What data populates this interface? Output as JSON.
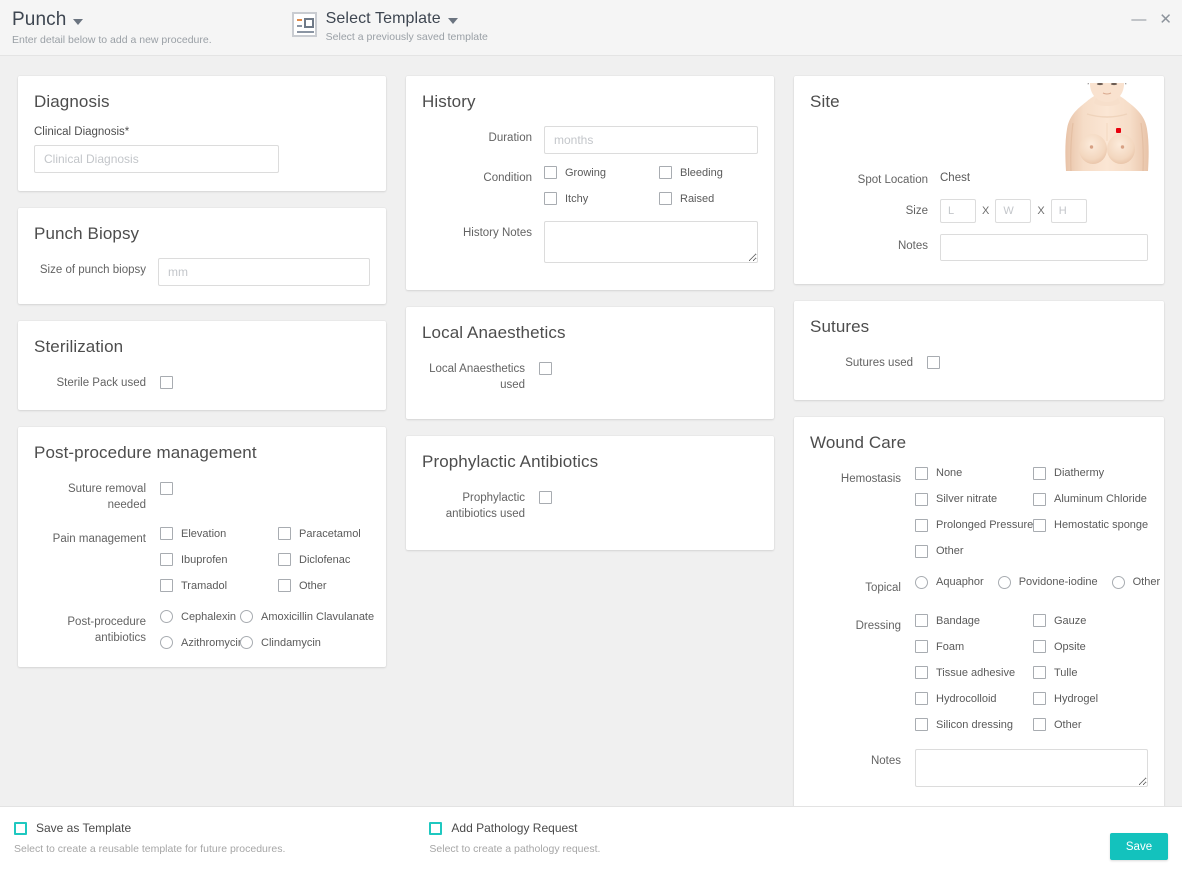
{
  "header": {
    "title": "Punch",
    "subtitle": "Enter detail below to add a new procedure.",
    "template_icon": "template-layout-icon",
    "template_title": "Select Template",
    "template_subtitle": "Select a previously saved template",
    "minimize_icon": "minimize-icon",
    "close_icon": "close-icon",
    "dropdown_icon": "chevron-down-icon"
  },
  "cards": {
    "diagnosis": {
      "title": "Diagnosis",
      "clinical_diagnosis_label": "Clinical Diagnosis*",
      "clinical_diagnosis_value": "",
      "clinical_diagnosis_placeholder": "Clinical Diagnosis"
    },
    "punch_biopsy": {
      "title": "Punch Biopsy",
      "size_label": "Size of punch biopsy",
      "size_value": "",
      "size_placeholder": "mm"
    },
    "sterilization": {
      "title": "Sterilization",
      "sterile_pack_label": "Sterile Pack used",
      "sterile_pack_checked": false
    },
    "post_procedure": {
      "title": "Post-procedure management",
      "suture_removal_label": "Suture removal needed",
      "suture_removal_checked": false,
      "pain_management_label": "Pain management",
      "pain_management_options": [
        "Elevation",
        "Paracetamol",
        "Ibuprofen",
        "Diclofenac",
        "Tramadol",
        "Other"
      ],
      "antibiotics_label": "Post-procedure antibiotics",
      "antibiotics_options": [
        "Cephalexin",
        "Amoxicillin Clavulanate",
        "Azithromycin",
        "Clindamycin"
      ]
    },
    "history": {
      "title": "History",
      "duration_label": "Duration",
      "duration_value": "",
      "duration_placeholder": "months",
      "condition_label": "Condition",
      "condition_options": [
        "Growing",
        "Bleeding",
        "Itchy",
        "Raised"
      ],
      "notes_label": "History Notes",
      "notes_value": ""
    },
    "local_anaesthetics": {
      "title": "Local Anaesthetics",
      "used_label": "Local Anaesthetics used",
      "used_checked": false
    },
    "prophylactic_antibiotics": {
      "title": "Prophylactic Antibiotics",
      "used_label": "Prophylactic antibiotics used",
      "used_checked": false
    },
    "site": {
      "title": "Site",
      "figure_name": "female-torso-body-map",
      "spot_marker_color": "#e8000d",
      "spot_location_label": "Spot Location",
      "spot_location_value": "Chest",
      "size_label": "Size",
      "size_l_placeholder": "L",
      "size_w_placeholder": "W",
      "size_h_placeholder": "H",
      "size_separator": "X",
      "notes_label": "Notes",
      "notes_value": ""
    },
    "sutures": {
      "title": "Sutures",
      "used_label": "Sutures used",
      "used_checked": false
    },
    "wound_care": {
      "title": "Wound Care",
      "hemostasis_label": "Hemostasis",
      "hemostasis_options": [
        "None",
        "Diathermy",
        "Silver nitrate",
        "Aluminum Chloride",
        "Prolonged Pressure",
        "Hemostatic sponge",
        "Other"
      ],
      "topical_label": "Topical",
      "topical_options": [
        "Aquaphor",
        "Povidone-iodine",
        "Other"
      ],
      "dressing_label": "Dressing",
      "dressing_options": [
        "Bandage",
        "Gauze",
        "Foam",
        "Opsite",
        "Tissue adhesive",
        "Tulle",
        "Hydrocolloid",
        "Hydrogel",
        "Silicon dressing",
        "Other"
      ],
      "notes_label": "Notes",
      "notes_value": ""
    }
  },
  "footer": {
    "save_template_label": "Save as Template",
    "save_template_hint": "Select to create a reusable template for future procedures.",
    "save_template_checked": false,
    "pathology_label": "Add Pathology Request",
    "pathology_hint": "Select to create a pathology request.",
    "pathology_checked": false,
    "save_button_label": "Save"
  },
  "colors": {
    "accent_teal": "#13c2bd",
    "page_bg": "#f0f0f0",
    "header_bg": "#f5f5f5",
    "spot_red": "#e8000d"
  }
}
